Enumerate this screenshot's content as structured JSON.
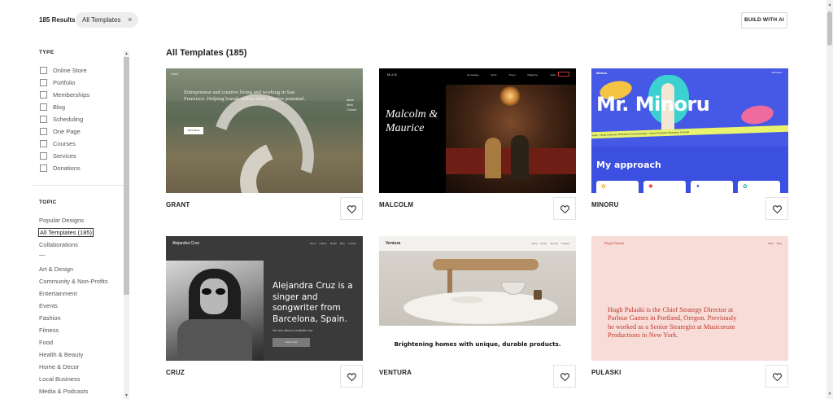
{
  "header": {
    "results_count": "185 Results",
    "filter_chip_label": "All Templates",
    "filter_chip_remove": "×",
    "build_button": "BUILD WITH AI"
  },
  "sidebar": {
    "type_heading": "TYPE",
    "type_options": [
      "Online Store",
      "Portfolio",
      "Memberships",
      "Blog",
      "Scheduling",
      "One Page",
      "Courses",
      "Services",
      "Donations"
    ],
    "topic_heading": "TOPIC",
    "topics_primary": [
      "Popular Designs",
      "All Templates (185)",
      "Collaborations"
    ],
    "topic_separator": "—",
    "topics": [
      "Art & Design",
      "Community & Non-Profits",
      "Entertainment",
      "Events",
      "Fashion",
      "Fitness",
      "Food",
      "Health & Beauty",
      "Home & Decor",
      "Local Business",
      "Media & Podcasts"
    ],
    "active_topic": "All Templates (185)"
  },
  "main": {
    "title": "All Templates (185)",
    "templates": [
      {
        "name": "GRANT",
        "preview": {
          "brand": "Grant",
          "text": "Entrepreneur and creative living and working in San Francisco. Helping brands realize their creative potential.",
          "button": "Work Book",
          "nav": [
            "About",
            "Work",
            "Contact"
          ]
        }
      },
      {
        "name": "MALCOLM",
        "preview": {
          "brand": "MUM",
          "title": "Malcolm & Maurice",
          "nav": [
            "Homepage",
            "Work",
            "Travel",
            "Magazine",
            "Video"
          ]
        }
      },
      {
        "name": "MINORU",
        "preview": {
          "brand": "Minoru",
          "big_text": "Mr. Minoru",
          "ribbon": "Concept • Visual Character Illustration Concept Design • Visual Character Illustration Concept",
          "section": "My approach",
          "nav": "Schedule"
        }
      },
      {
        "name": "CRUZ",
        "preview": {
          "brand": "Alejandra Cruz",
          "headline": "Alejandra Cruz is a singer and songwriter from Barcelona, Spain.",
          "sub": "Her new album is available now",
          "button": "Listen Now",
          "nav": [
            "About",
            "Gallery",
            "Media",
            "Blog",
            "Contact"
          ]
        }
      },
      {
        "name": "VENTURA",
        "preview": {
          "brand": "Ventura",
          "headline": "Brightening homes with unique, durable products.",
          "nav": [
            "Shop",
            "About",
            "Journal",
            "Contact"
          ]
        }
      },
      {
        "name": "PULASKI",
        "preview": {
          "brand": "Hugh Pulaski",
          "bio": "Hugh Pulaski is the Chief Strategy Director at Parlour Games in Portland, Oregon. Previously he worked as a Senior Strategist at Musicorum Productions in New York.",
          "nav": [
            "Work",
            "Blog"
          ]
        }
      }
    ]
  },
  "colors": {
    "chip_bg": "#ededed",
    "text_primary": "#222222",
    "text_secondary": "#555555",
    "pulaski_accent": "#c0392b",
    "minoru_blue": "#3b4fe0"
  }
}
